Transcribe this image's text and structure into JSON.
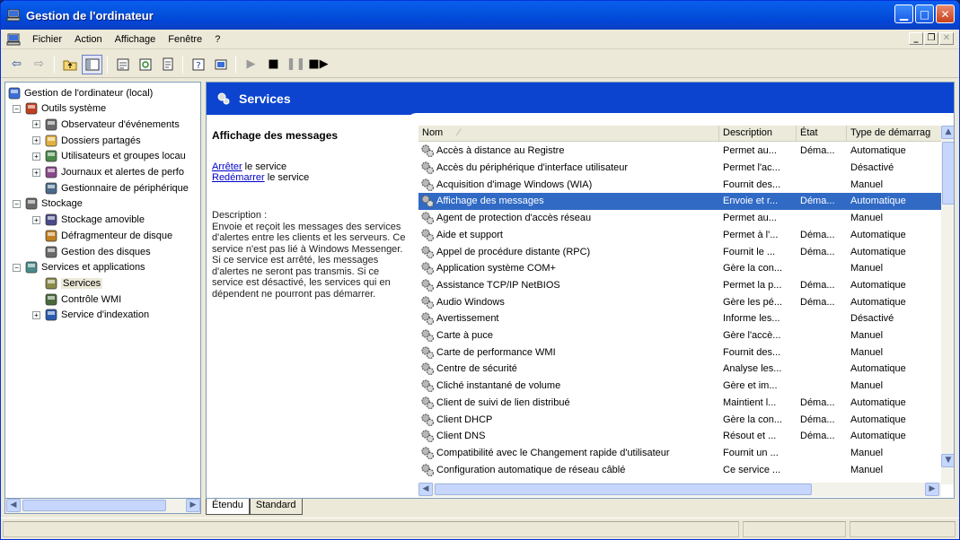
{
  "window": {
    "title": "Gestion de l'ordinateur"
  },
  "menu": [
    "Fichier",
    "Action",
    "Affichage",
    "Fenêtre",
    "?"
  ],
  "tree": [
    {
      "label": "Gestion de l'ordinateur (local)",
      "level": 0,
      "icon": "computer-icon"
    },
    {
      "label": "Outils système",
      "level": 1,
      "exp": "−",
      "icon": "tools-icon"
    },
    {
      "label": "Observateur d'événements",
      "level": 2,
      "exp": "+",
      "icon": "event-viewer-icon"
    },
    {
      "label": "Dossiers partagés",
      "level": 2,
      "exp": "+",
      "icon": "shared-folder-icon"
    },
    {
      "label": "Utilisateurs et groupes locau",
      "level": 2,
      "exp": "+",
      "icon": "users-icon"
    },
    {
      "label": "Journaux et alertes de perfo",
      "level": 2,
      "exp": "+",
      "icon": "perf-logs-icon"
    },
    {
      "label": "Gestionnaire de périphérique",
      "level": 2,
      "icon": "device-manager-icon"
    },
    {
      "label": "Stockage",
      "level": 1,
      "exp": "−",
      "icon": "storage-icon"
    },
    {
      "label": "Stockage amovible",
      "level": 2,
      "exp": "+",
      "icon": "removable-storage-icon"
    },
    {
      "label": "Défragmenteur de disque",
      "level": 2,
      "icon": "defrag-icon"
    },
    {
      "label": "Gestion des disques",
      "level": 2,
      "icon": "disk-management-icon"
    },
    {
      "label": "Services et applications",
      "level": 1,
      "exp": "−",
      "icon": "services-apps-icon"
    },
    {
      "label": "Services",
      "level": 2,
      "icon": "services-gear-icon",
      "selected": true
    },
    {
      "label": "Contrôle WMI",
      "level": 2,
      "icon": "wmi-icon"
    },
    {
      "label": "Service d'indexation",
      "level": 2,
      "exp": "+",
      "icon": "indexing-icon"
    }
  ],
  "header": {
    "title": "Services"
  },
  "ext": {
    "service_name": "Affichage des messages",
    "stop_link": "Arrêter",
    "stop_suffix": " le service",
    "restart_link": "Redémarrer",
    "restart_suffix": " le service",
    "desc_label": "Description :",
    "desc_text": "Envoie et reçoit les messages des services d'alertes entre les clients et les serveurs. Ce service n'est pas lié à Windows Messenger. Si ce service est arrêté, les messages d'alertes ne seront pas transmis. Si ce service est désactivé, les services qui en dépendent ne pourront pas démarrer."
  },
  "columns": [
    "Nom",
    "Description",
    "État",
    "Type de démarrag"
  ],
  "services": [
    [
      "Accès à distance au Registre",
      "Permet au...",
      "Déma...",
      "Automatique"
    ],
    [
      "Accès du périphérique d'interface utilisateur",
      "Permet l'ac...",
      "",
      "Désactivé"
    ],
    [
      "Acquisition d'image Windows (WIA)",
      "Fournit des...",
      "",
      "Manuel"
    ],
    [
      "Affichage des messages",
      "Envoie et r...",
      "Déma...",
      "Automatique"
    ],
    [
      "Agent de protection d'accès réseau",
      "Permet au...",
      "",
      "Manuel"
    ],
    [
      "Aide et support",
      "Permet à l'...",
      "Déma...",
      "Automatique"
    ],
    [
      "Appel de procédure distante (RPC)",
      "Fournit le ...",
      "Déma...",
      "Automatique"
    ],
    [
      "Application système COM+",
      "Gère la con...",
      "",
      "Manuel"
    ],
    [
      "Assistance TCP/IP NetBIOS",
      "Permet la p...",
      "Déma...",
      "Automatique"
    ],
    [
      "Audio Windows",
      "Gère les pé...",
      "Déma...",
      "Automatique"
    ],
    [
      "Avertissement",
      "Informe les...",
      "",
      "Désactivé"
    ],
    [
      "Carte à puce",
      "Gère l'accè...",
      "",
      "Manuel"
    ],
    [
      "Carte de performance WMI",
      "Fournit des...",
      "",
      "Manuel"
    ],
    [
      "Centre de sécurité",
      "Analyse les...",
      "",
      "Automatique"
    ],
    [
      "Cliché instantané de volume",
      "Gère et im...",
      "",
      "Manuel"
    ],
    [
      "Client de suivi de lien distribué",
      "Maintient l...",
      "Déma...",
      "Automatique"
    ],
    [
      "Client DHCP",
      "Gère la con...",
      "Déma...",
      "Automatique"
    ],
    [
      "Client DNS",
      "Résout et ...",
      "Déma...",
      "Automatique"
    ],
    [
      "Compatibilité avec le Changement rapide d'utilisateur",
      "Fournit un ...",
      "",
      "Manuel"
    ],
    [
      "Configuration automatique de réseau câblé",
      "Ce service ...",
      "",
      "Manuel"
    ]
  ],
  "selected_index": 3,
  "tabs": [
    "Étendu",
    "Standard"
  ]
}
